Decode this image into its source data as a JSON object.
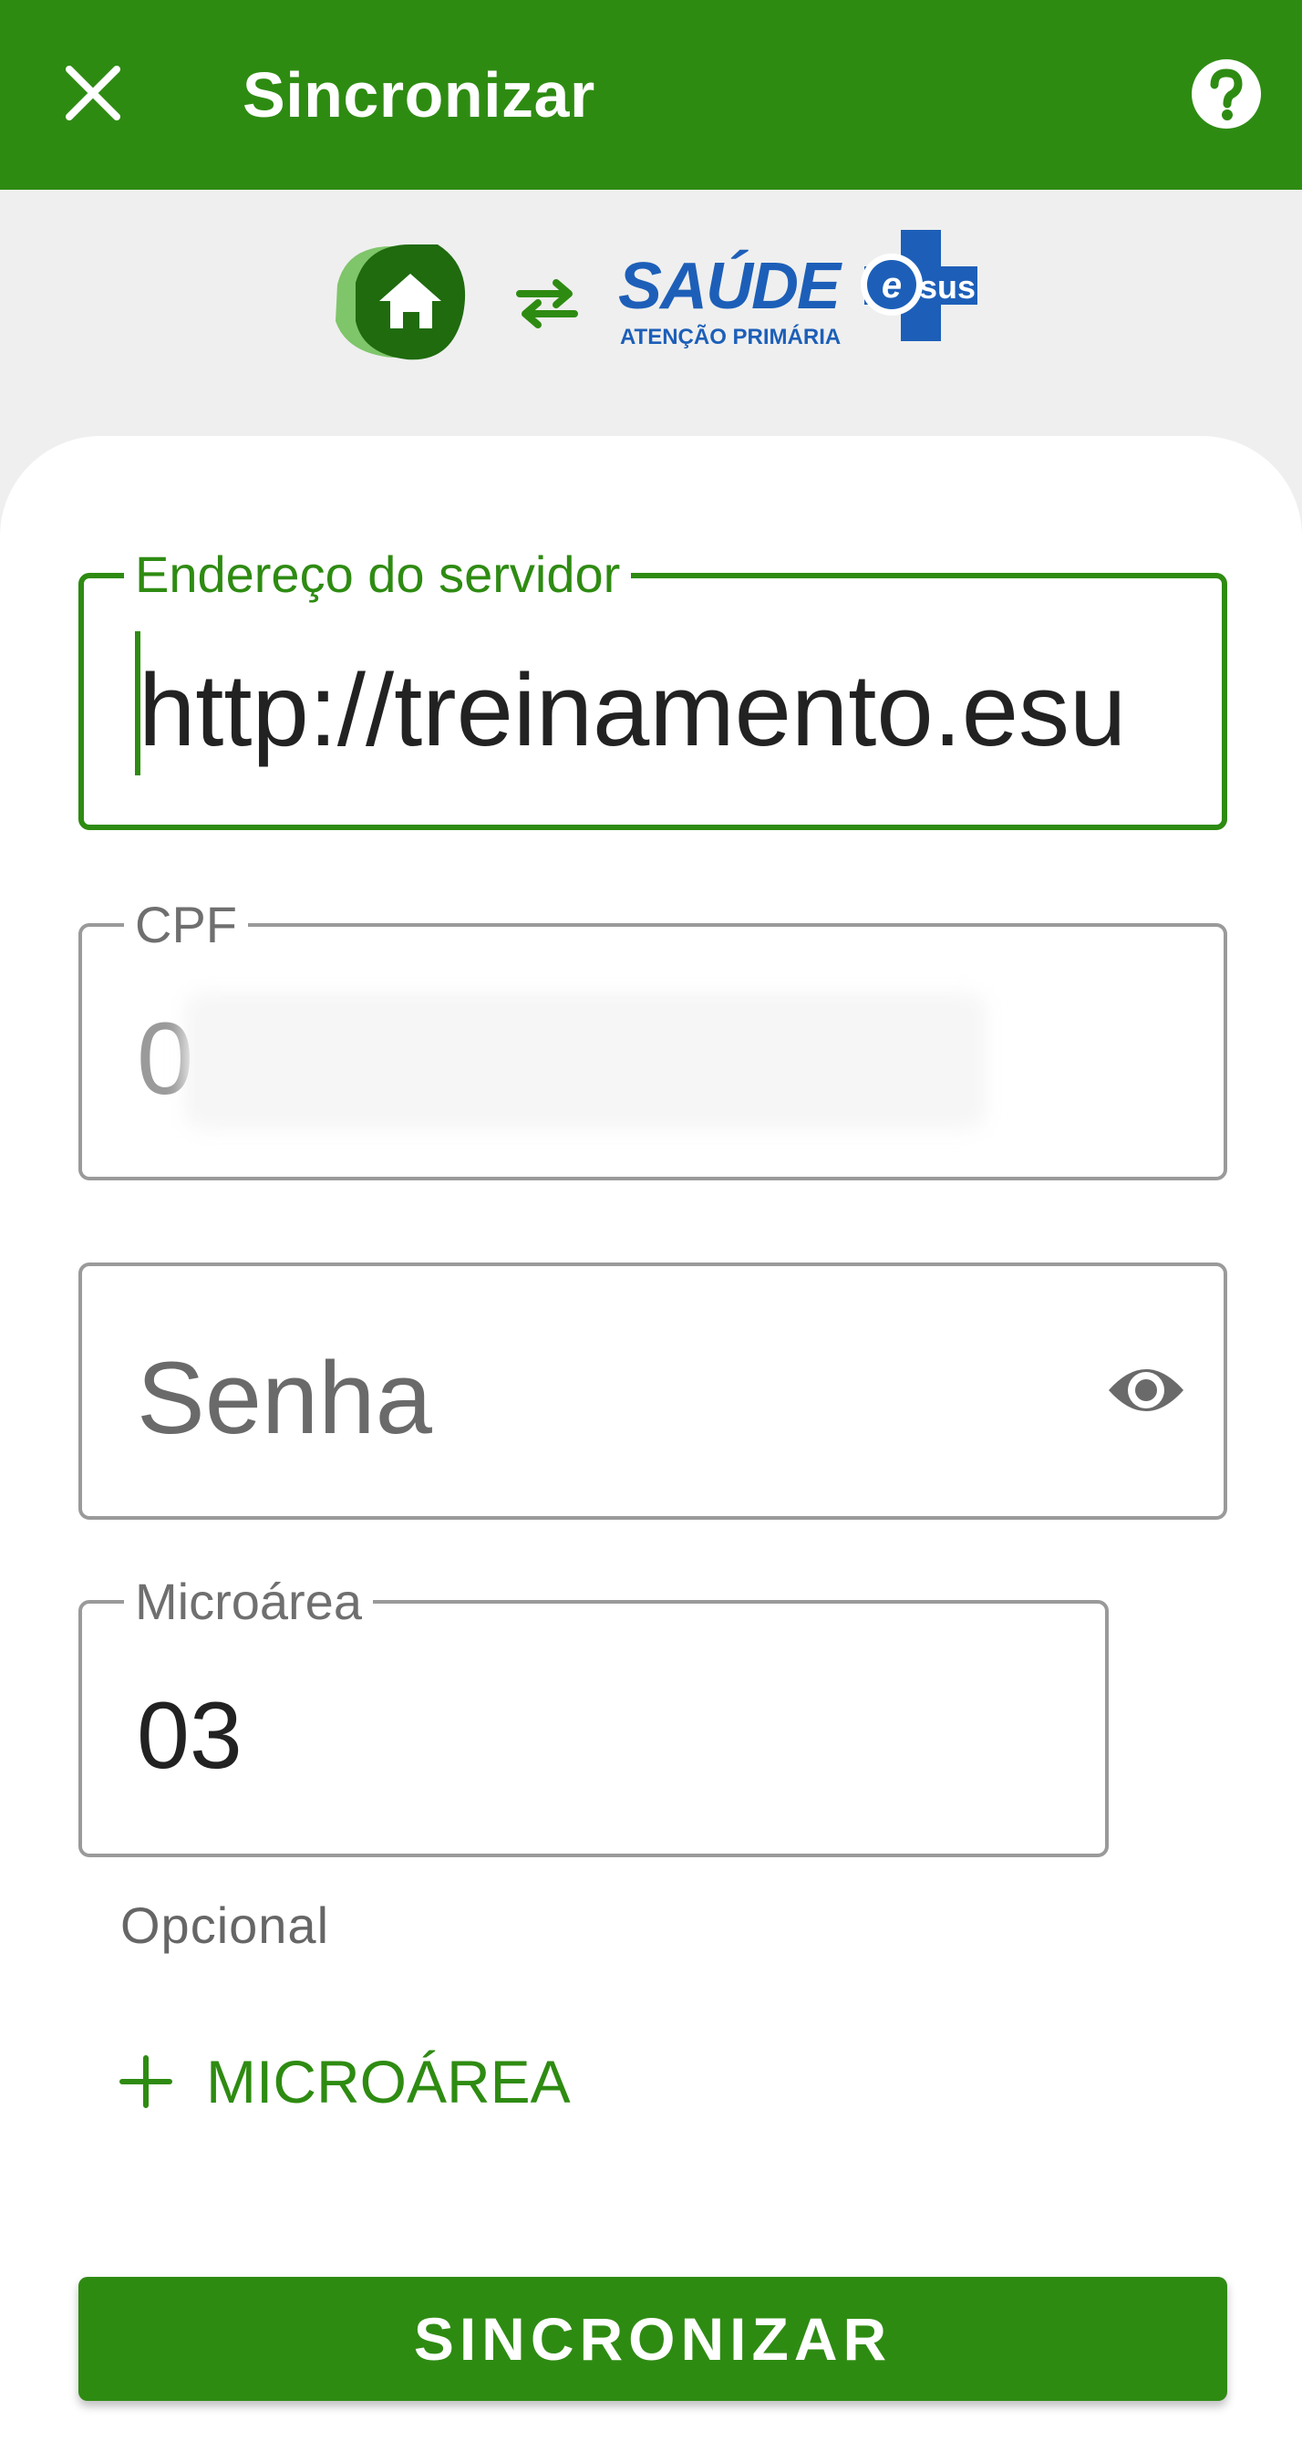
{
  "appbar": {
    "title": "Sincronizar",
    "close_icon": "close-icon",
    "help_icon": "help-icon"
  },
  "logos": {
    "left_icon": "home-icon",
    "sync_icon": "swap-arrows-icon",
    "brand_name": "SAÚDE",
    "brand_sub": "ATENÇÃO PRIMÁRIA",
    "brand_badge": "sus"
  },
  "form": {
    "server": {
      "label": "Endereço do servidor",
      "value": "http://treinamento.esu"
    },
    "cpf": {
      "label": "CPF",
      "value": "0"
    },
    "password": {
      "placeholder": "Senha",
      "toggle_icon": "eye-icon"
    },
    "microarea": {
      "label": "Microárea",
      "value": "03",
      "helper": "Opcional"
    },
    "add_microarea": "MICROÁREA",
    "submit": "SINCRONIZAR"
  },
  "colors": {
    "primary": "#2e8b12",
    "background": "#efefef",
    "brand_blue": "#1d5fb8"
  }
}
